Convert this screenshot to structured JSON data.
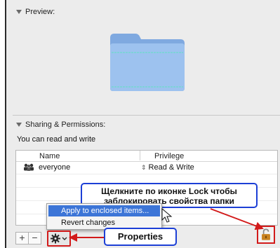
{
  "preview": {
    "header": "Preview:"
  },
  "sharing": {
    "header": "Sharing & Permissions:",
    "note": "You can read and write",
    "columns": [
      "Name",
      "Privilege"
    ],
    "rows": [
      {
        "name": "everyone",
        "privilege": "Read & Write"
      }
    ]
  },
  "context_menu": {
    "items": [
      "Apply to enclosed items...",
      "Revert changes"
    ]
  },
  "toolbar": {
    "add": "+",
    "remove": "−"
  },
  "annotations": {
    "lock_callout": [
      "Щелкните по иконке Lock чтобы",
      "заблокировать свойства папки"
    ],
    "properties_callout": "Properties"
  },
  "colors": {
    "highlight": "#3c75d7",
    "annotation_border": "#1c3fd6",
    "annotation_red": "#d21a1a",
    "folder": "#8fb6e8"
  },
  "icons": {
    "folder": "folder-icon",
    "group": "group-icon",
    "gear": "gear-icon",
    "lock": "lock-icon",
    "cursor": "pointer-cursor-icon"
  }
}
